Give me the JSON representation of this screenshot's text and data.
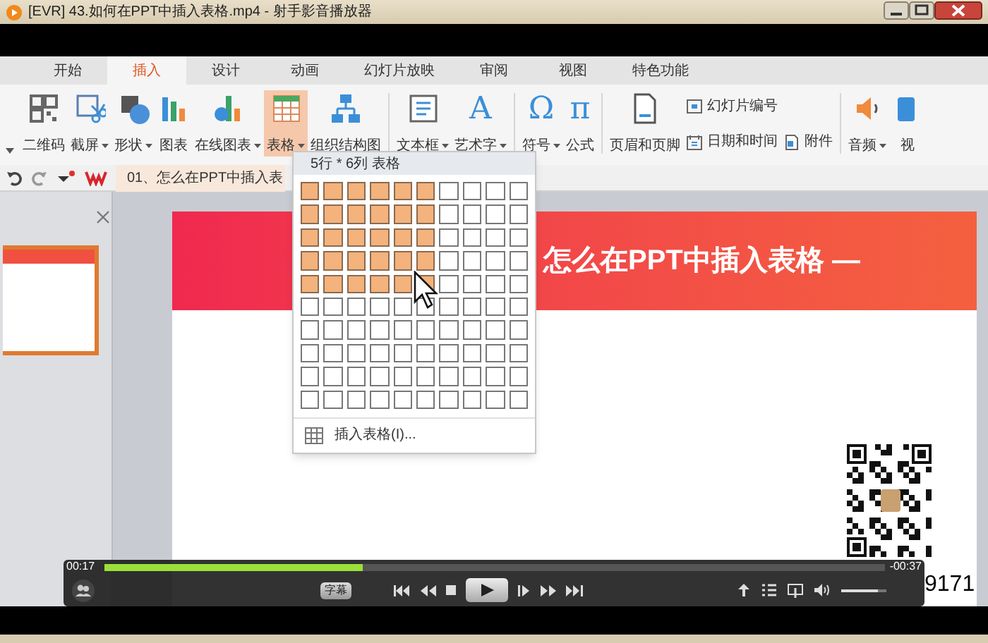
{
  "window": {
    "title": "[EVR] 43.如何在PPT中插入表格.mp4 - 射手影音播放器"
  },
  "tabs": [
    {
      "label": "开始",
      "selected": false
    },
    {
      "label": "插入",
      "selected": true
    },
    {
      "label": "设计",
      "selected": false
    },
    {
      "label": "动画",
      "selected": false
    },
    {
      "label": "幻灯片放映",
      "selected": false
    },
    {
      "label": "审阅",
      "selected": false
    },
    {
      "label": "视图",
      "selected": false
    },
    {
      "label": "特色功能",
      "selected": false
    }
  ],
  "ribbon": {
    "items": [
      {
        "kind": "large",
        "label": "二维码",
        "dropdown": false,
        "selected": false
      },
      {
        "kind": "large",
        "label": "截屏",
        "dropdown": true,
        "selected": false
      },
      {
        "kind": "large",
        "label": "形状",
        "dropdown": true,
        "selected": false
      },
      {
        "kind": "large",
        "label": "图表",
        "dropdown": false,
        "selected": false
      },
      {
        "kind": "large",
        "label": "在线图表",
        "dropdown": true,
        "selected": false
      },
      {
        "kind": "large",
        "label": "表格",
        "dropdown": true,
        "selected": true
      },
      {
        "kind": "large",
        "label": "组织结构图",
        "dropdown": false,
        "selected": false
      },
      {
        "kind": "separator"
      },
      {
        "kind": "large",
        "label": "文本框",
        "dropdown": true,
        "selected": false
      },
      {
        "kind": "glyph",
        "glyph": "A",
        "label": "艺术字",
        "dropdown": true,
        "selected": false
      },
      {
        "kind": "separator"
      },
      {
        "kind": "glyph",
        "glyph": "Ω",
        "label": "符号",
        "dropdown": true,
        "selected": false
      },
      {
        "kind": "glyph",
        "glyph": "π",
        "label": "公式",
        "dropdown": false,
        "selected": false
      },
      {
        "kind": "separator"
      },
      {
        "kind": "large",
        "label": "页眉和页脚",
        "dropdown": false,
        "selected": false
      },
      {
        "kind": "small",
        "items": [
          {
            "label": "幻灯片编号"
          },
          {
            "label": "日期和时间"
          }
        ]
      },
      {
        "kind": "small",
        "items": [
          {
            "label": "附件"
          }
        ]
      },
      {
        "kind": "separator"
      },
      {
        "kind": "large",
        "label": "音频",
        "dropdown": true,
        "selected": false
      },
      {
        "kind": "large",
        "label": "视",
        "dropdown": false,
        "selected": false
      }
    ]
  },
  "doc_tab": {
    "title": "01、怎么在PPT中插入表"
  },
  "table_menu": {
    "header": "5行 * 6列 表格",
    "footer": "插入表格(I)...",
    "grid": [
      {
        "selected": [
          true,
          true,
          true,
          true,
          true,
          true,
          false,
          false,
          false,
          false
        ]
      },
      {
        "selected": [
          true,
          true,
          true,
          true,
          true,
          true,
          false,
          false,
          false,
          false
        ]
      },
      {
        "selected": [
          true,
          true,
          true,
          true,
          true,
          true,
          false,
          false,
          false,
          false
        ]
      },
      {
        "selected": [
          true,
          true,
          true,
          true,
          true,
          true,
          false,
          false,
          false,
          false
        ]
      },
      {
        "selected": [
          true,
          true,
          true,
          true,
          true,
          true,
          false,
          false,
          false,
          false
        ]
      },
      {
        "selected": [
          false,
          false,
          false,
          false,
          false,
          false,
          false,
          false,
          false,
          false
        ]
      },
      {
        "selected": [
          false,
          false,
          false,
          false,
          false,
          false,
          false,
          false,
          false,
          false
        ]
      },
      {
        "selected": [
          false,
          false,
          false,
          false,
          false,
          false,
          false,
          false,
          false,
          false
        ]
      },
      {
        "selected": [
          false,
          false,
          false,
          false,
          false,
          false,
          false,
          false,
          false,
          false
        ]
      },
      {
        "selected": [
          false,
          false,
          false,
          false,
          false,
          false,
          false,
          false,
          false,
          false
        ]
      }
    ]
  },
  "slide": {
    "title": "怎么在PPT中插入表格 —",
    "phone_fragment": "9171"
  },
  "player": {
    "elapsed": "00:17",
    "remaining": "-00:37",
    "progress": {
      "level": 0.33
    },
    "subtitle_button": "字幕",
    "volume": {
      "level": 0.8
    }
  }
}
